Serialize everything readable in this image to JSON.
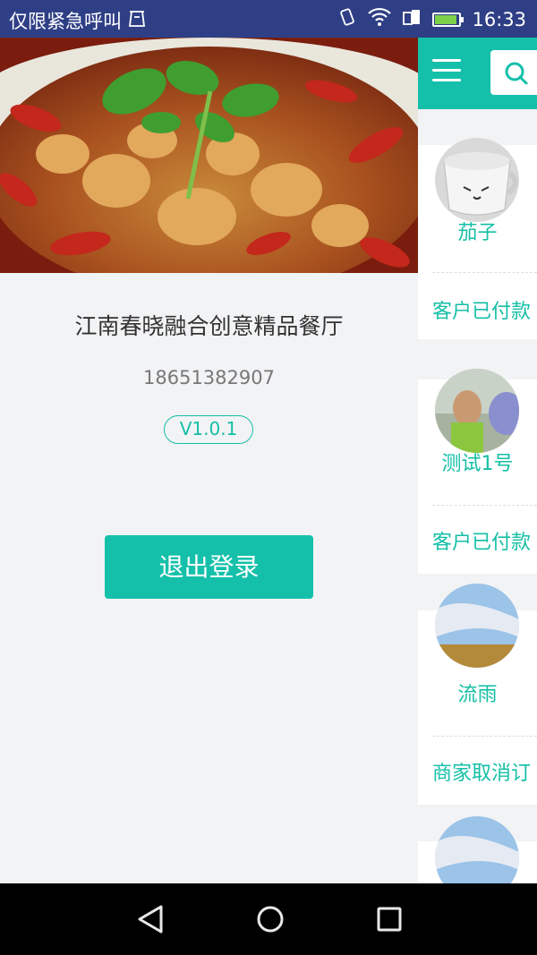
{
  "status_bar": {
    "left_text": "仅限紧急呼叫",
    "time": "16:33",
    "colors": {
      "background": "#2f3f86",
      "battery": "#7cd14a"
    },
    "icons": [
      "sim-icon",
      "vibrate-icon",
      "wifi-icon",
      "data-icon",
      "battery-icon"
    ]
  },
  "drawer": {
    "restaurant_name": "江南春晓融合创意精品餐厅",
    "phone": "18651382907",
    "version": "V1.0.1",
    "logout_label": "退出登录",
    "accent_color": "#15c0aa"
  },
  "main": {
    "header_icons": [
      "menu-icon",
      "search-icon"
    ],
    "orders": [
      {
        "customer": "茄子",
        "status": "客户已付款"
      },
      {
        "customer": "测试1号",
        "status": "客户已付款"
      },
      {
        "customer": "流雨",
        "status": "商家取消订"
      }
    ]
  },
  "nav_bar": {
    "icons": [
      "back-icon",
      "home-icon",
      "recents-icon"
    ]
  }
}
